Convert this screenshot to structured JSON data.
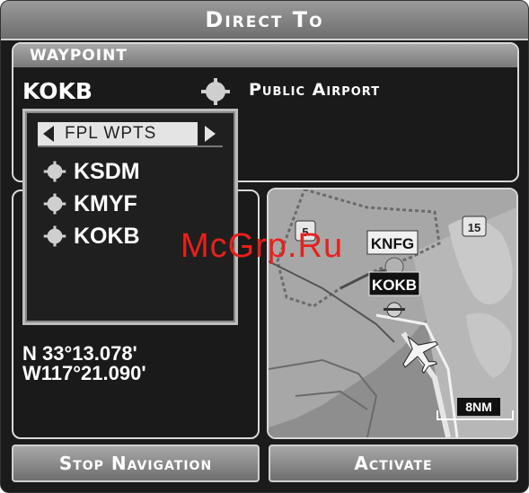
{
  "title": "Direct To",
  "waypoint": {
    "header": "WAYPOINT",
    "ident": "KOKB",
    "type": "Public Airport"
  },
  "popup": {
    "label": "FPL WPTS",
    "items": [
      "KSDM",
      "KMYF",
      "KOKB"
    ]
  },
  "position": {
    "lat": "N  33°13.078'",
    "lon": "W117°21.090'"
  },
  "map": {
    "labels": {
      "knfg": "KNFG",
      "kokb": "KOKB"
    },
    "highways": {
      "i5": "5",
      "i15": "15"
    },
    "range": "8NM"
  },
  "buttons": {
    "stop": "Stop Navigation",
    "activate": "Activate"
  },
  "watermark": "McGrp.Ru",
  "colors": {
    "accent": "#e8201c",
    "panel": "#1a1a1a",
    "bar": "#8a8a8a"
  }
}
